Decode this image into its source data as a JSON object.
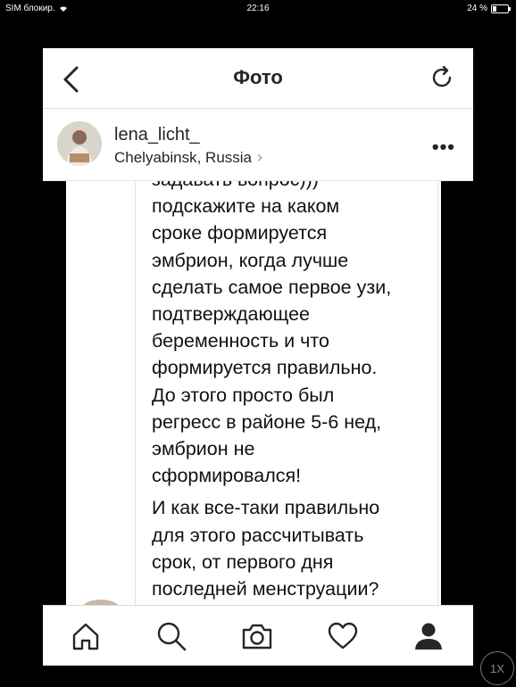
{
  "status_bar": {
    "carrier": "SIM блокир.",
    "time": "22:16",
    "battery": "24 %",
    "battery_level": 0.24
  },
  "header": {
    "title": "Фото",
    "back_icon": "chevron-left-icon",
    "refresh_icon": "refresh-icon"
  },
  "post": {
    "username": "lena_licht_",
    "location": "Chelyabinsk, Russia",
    "location_chevron": "›",
    "more_label": "•••"
  },
  "message": {
    "lines_top": [
      "задавать вопрос)))",
      "подскажите на каком",
      "сроке формируется",
      "эмбрион, когда лучше",
      "сделать самое первое узи,",
      "подтверждающее",
      "беременность и что",
      "формируется правильно.",
      "До этого просто был",
      "регресс в районе 5-6 нед,",
      "эмбрион не",
      "сформировался!"
    ],
    "lines_bottom": [
      "И как все-таки правильно",
      "для этого рассчитывать",
      "срок, от первого дня",
      "последней менструации?"
    ]
  },
  "tabbar": {
    "items": [
      "home-icon",
      "search-icon",
      "camera-icon",
      "heart-icon",
      "profile-icon"
    ],
    "active": "profile-icon"
  },
  "zoom_badge": "1X"
}
